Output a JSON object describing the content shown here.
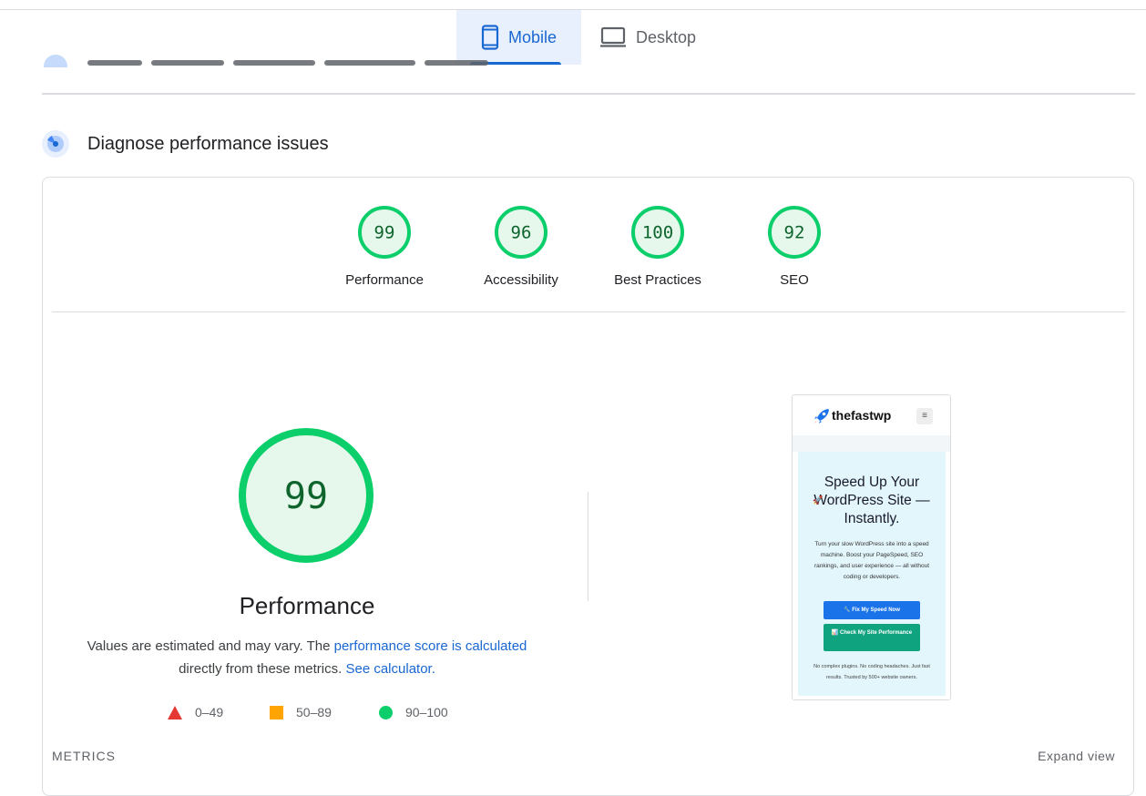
{
  "tabs": {
    "mobile_label": "Mobile",
    "desktop_label": "Desktop"
  },
  "section": {
    "title": "Diagnose performance issues"
  },
  "scores": [
    {
      "label": "Performance",
      "value": 99
    },
    {
      "label": "Accessibility",
      "value": 96
    },
    {
      "label": "Best Practices",
      "value": 100
    },
    {
      "label": "SEO",
      "value": 92
    }
  ],
  "performance": {
    "score": 99,
    "title": "Performance",
    "desc_prefix": "Values are estimated and may vary. The",
    "desc_link1": "performance score is calculated",
    "desc_middle": "directly from these metrics.",
    "desc_link2": "See calculator."
  },
  "legend": [
    {
      "shape": "triangle",
      "color": "#e53935",
      "label": "0–49"
    },
    {
      "shape": "square",
      "color": "#ffa400",
      "label": "50–89"
    },
    {
      "shape": "circle",
      "color": "#0cce6b",
      "label": "90–100"
    }
  ],
  "metrics": {
    "label": "METRICS",
    "expand_label": "Expand view"
  },
  "screenshot": {
    "logo": "thefastwp",
    "menu_icon": "≡",
    "headline": "Speed Up Your WordPress Site — Instantly.",
    "paragraph": "Turn your slow WordPress site into a speed machine. Boost your PageSpeed, SEO rankings, and user experience — all without coding or developers.",
    "button1": "🔧 Fix My Speed Now",
    "button2": "📊 Check My Site Performance",
    "footer": "No complex plugins. No coding headaches. Just fast results. Trusted by 500+ website owners."
  },
  "colors": {
    "pass_ring": "#0cce6b",
    "pass_fill": "#e6f7ec",
    "pass_text": "#0d652d",
    "accent": "#1967d2"
  }
}
